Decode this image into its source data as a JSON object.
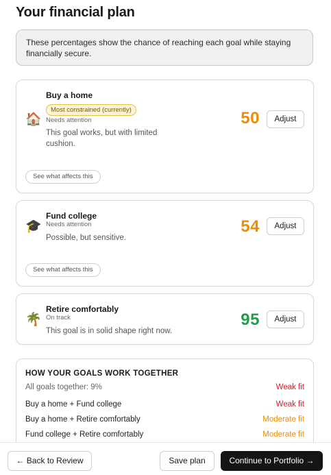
{
  "page": {
    "title": "Your financial plan",
    "info_text": "These percentages show the chance of reaching each goal while staying financially secure."
  },
  "goals": [
    {
      "icon": "house-icon",
      "icon_glyph": "🏠",
      "name": "Buy a home",
      "badge": "Most constrained (currently)",
      "status": "Needs attention",
      "description": "This goal works, but with limited cushion.",
      "score": "50",
      "score_color": "#f08c00",
      "adjust_label": "Adjust",
      "affects_label": "See what affects this"
    },
    {
      "icon": "graduation-cap-icon",
      "icon_glyph": "🎓",
      "name": "Fund college",
      "status": "Needs attention",
      "description": "Possible, but sensitive.",
      "score": "54",
      "score_color": "#f08c00",
      "adjust_label": "Adjust",
      "affects_label": "See what affects this"
    },
    {
      "icon": "palm-tree-icon",
      "icon_glyph": "🌴",
      "name": "Retire comfortably",
      "status": "On track",
      "description": "This goal is in solid shape right now.",
      "score": "95",
      "score_color": "#1f9d4b",
      "adjust_label": "Adjust"
    }
  ],
  "synergy": {
    "heading": "HOW YOUR GOALS WORK TOGETHER",
    "rows": [
      {
        "label": "All goals together: 9%",
        "fit": "Weak fit",
        "fit_color": "#d3202f"
      },
      {
        "label": "Buy a home + Fund college",
        "fit": "Weak fit",
        "fit_color": "#d3202f"
      },
      {
        "label": "Buy a home + Retire comfortably",
        "fit": "Moderate fit",
        "fit_color": "#f08c00"
      },
      {
        "label": "Fund college + Retire comfortably",
        "fit": "Moderate fit",
        "fit_color": "#f08c00"
      }
    ]
  },
  "footer": {
    "back_label": "← Back to Review",
    "save_label": "Save plan",
    "continue_label": "Continue to Portfolio →"
  },
  "colors": {
    "accent_amber": "#f08c00",
    "accent_green": "#1f9d4b",
    "accent_red": "#d3202f",
    "primary_button": "#151515"
  }
}
